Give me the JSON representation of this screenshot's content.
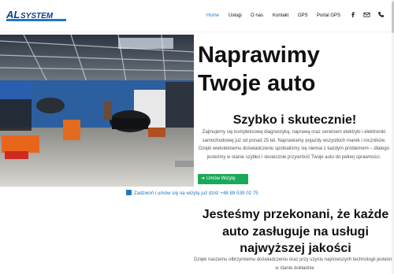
{
  "header": {
    "logo_text": "ALSYSTEM",
    "nav": [
      {
        "label": "Home",
        "active": true
      },
      {
        "label": "Usługi",
        "active": false
      },
      {
        "label": "O nas",
        "active": false
      },
      {
        "label": "Kontakt",
        "active": false
      },
      {
        "label": "GPS",
        "active": false
      },
      {
        "label": "Portal GPS",
        "active": false
      }
    ],
    "icons": [
      "facebook-icon",
      "mail-icon",
      "phone-icon"
    ]
  },
  "hero": {
    "title_line1": "Naprawimy",
    "title_line2": "Twoje auto",
    "subtitle": "Szybko i skutecznie!",
    "description": "Zajmujemy się kompleksową diagnostyką, naprawą oraz serwisem elektryki i elektroniki samochodowej już od ponad 25 lat. Naprawiamy pojazdy wszystkich marek i roczników. Dzięki wieloletniemu doświadczeniu spotkaliśmy się niemal z każdym problemem – dlatego jesteśmy w stanie szybko i skutecznie przywrócić Twoje auto do pełnej sprawności.",
    "cta_label": "Umów Wizytę"
  },
  "call": {
    "text": "Zadzwoń i umów się na wizytę już dziś! +48 89 539 02 75"
  },
  "section": {
    "title": "Jesteśmy przekonani, że każde auto zasługuje na usługi najwyższej jakości",
    "description": "Dzięki naszemu olbrzymiemu doświadczeniu oraz przy użyciu najnowszych technologii jesteśmy w stanie dokładnie"
  },
  "colors": {
    "accent": "#1f78c4",
    "cta": "#1aa95a"
  }
}
